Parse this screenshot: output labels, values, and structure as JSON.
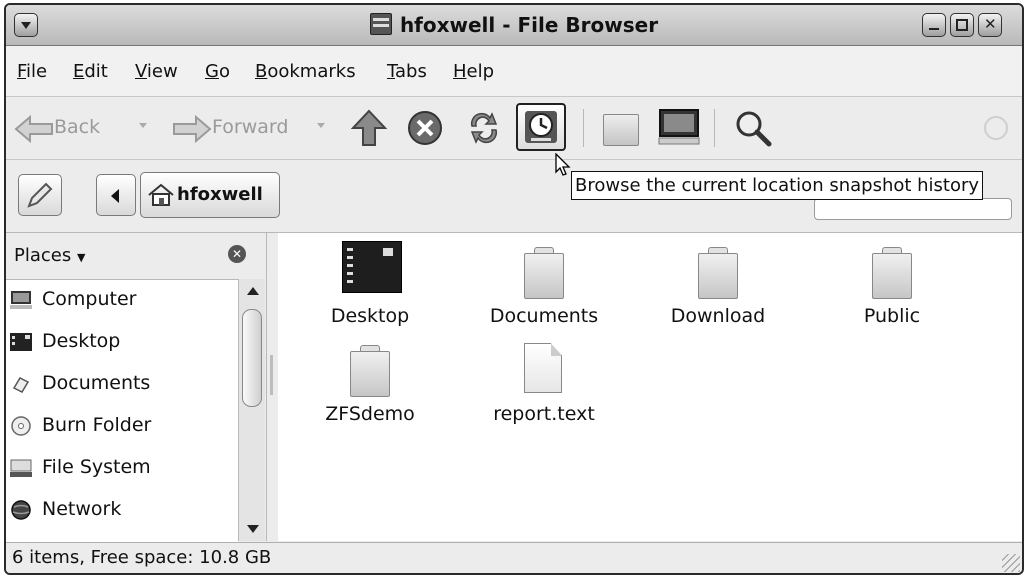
{
  "window": {
    "title": "hfoxwell - File Browser"
  },
  "menubar": {
    "items": [
      {
        "mnemonic": "F",
        "rest": "ile"
      },
      {
        "mnemonic": "E",
        "rest": "dit"
      },
      {
        "mnemonic": "V",
        "rest": "iew"
      },
      {
        "mnemonic": "G",
        "rest": "o"
      },
      {
        "mnemonic": "B",
        "rest": "ookmarks"
      },
      {
        "mnemonic": "T",
        "rest": "abs"
      },
      {
        "mnemonic": "H",
        "rest": "elp"
      }
    ]
  },
  "toolbar": {
    "back_label": "Back",
    "forward_label": "Forward"
  },
  "tooltip": {
    "text": "Browse the current location snapshot history"
  },
  "location": {
    "crumb_label": "hfoxwell"
  },
  "sidebar": {
    "header": "Places",
    "items": [
      {
        "label": "Computer",
        "icon": "computer-icon"
      },
      {
        "label": "Desktop",
        "icon": "desktop-icon"
      },
      {
        "label": "Documents",
        "icon": "documents-icon"
      },
      {
        "label": "Burn Folder",
        "icon": "disc-icon"
      },
      {
        "label": "File System",
        "icon": "harddisk-icon"
      },
      {
        "label": "Network",
        "icon": "network-icon"
      }
    ]
  },
  "files": [
    {
      "name": "Desktop",
      "icon": "desktop-icon"
    },
    {
      "name": "Documents",
      "icon": "folder-icon"
    },
    {
      "name": "Download",
      "icon": "folder-icon"
    },
    {
      "name": "Public",
      "icon": "folder-icon"
    },
    {
      "name": "ZFSdemo",
      "icon": "folder-icon"
    },
    {
      "name": "report.text",
      "icon": "file-icon"
    }
  ],
  "status": {
    "text": "6 items, Free space: 10.8 GB"
  }
}
